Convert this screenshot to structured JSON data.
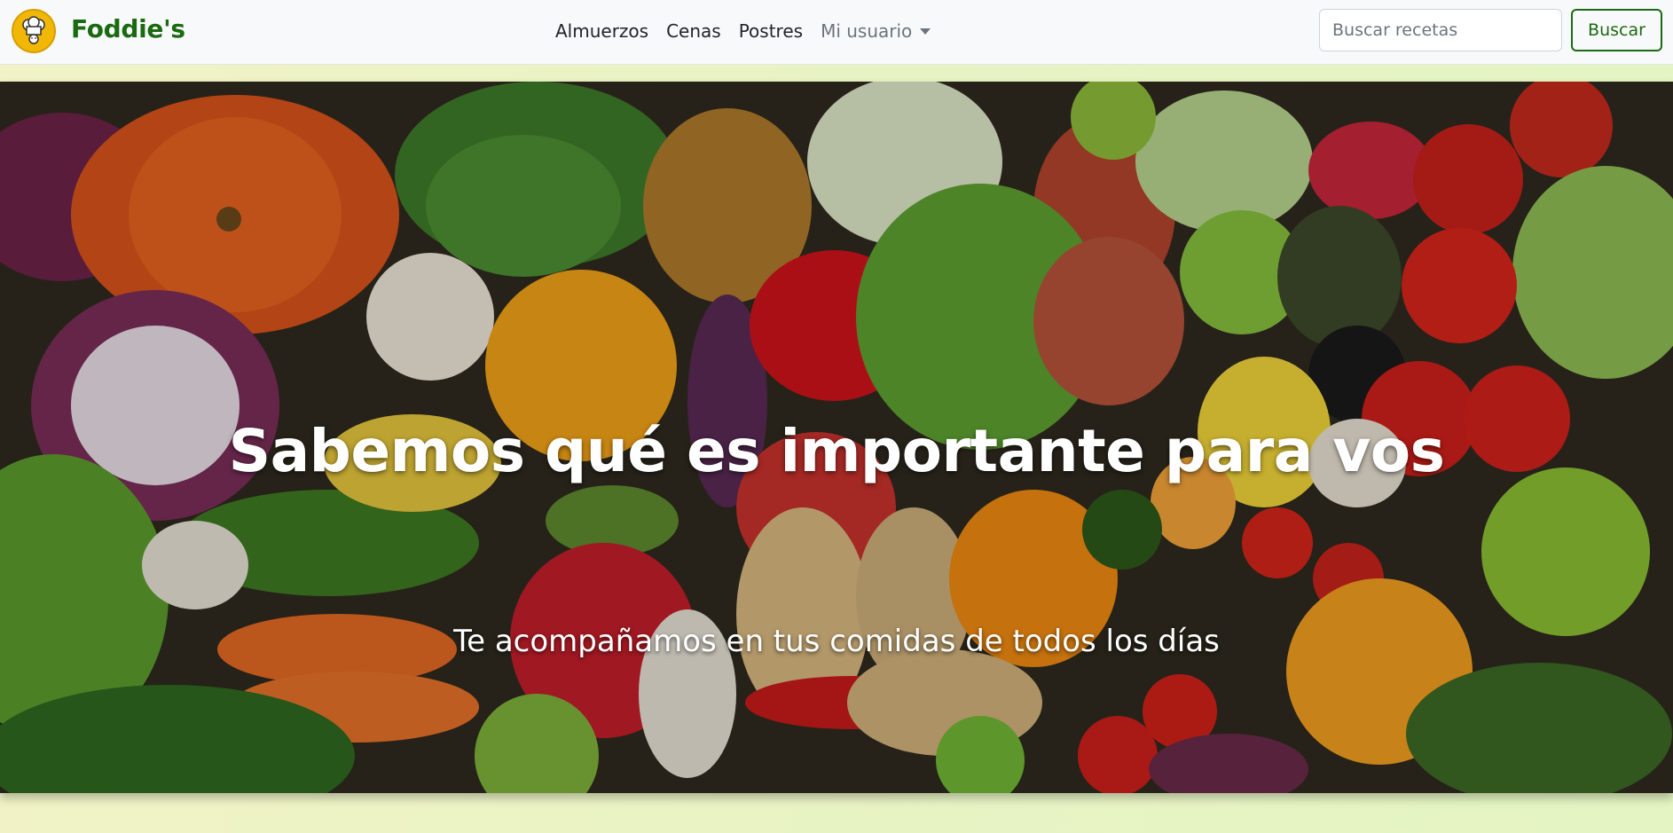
{
  "brand": {
    "name": "Foddie's",
    "logo_icon": "chef-hat-icon",
    "brand_color": "#1b6a12",
    "logo_color": "#f2b705"
  },
  "nav": {
    "links": [
      "Almuerzos",
      "Cenas",
      "Postres"
    ],
    "user_menu_label": "Mi usuario",
    "user_menu_icon": "chevron-down-icon"
  },
  "search": {
    "placeholder": "Buscar recetas",
    "value": "",
    "button_label": "Buscar"
  },
  "hero": {
    "title": "Sabemos qué es importante para vos",
    "subtitle": "Te acompañamos en tus comidas de todos los días"
  },
  "colors": {
    "navbar_bg": "#f8f9fa",
    "page_bg": "#e8f3c4",
    "accent": "#1b6a12"
  }
}
